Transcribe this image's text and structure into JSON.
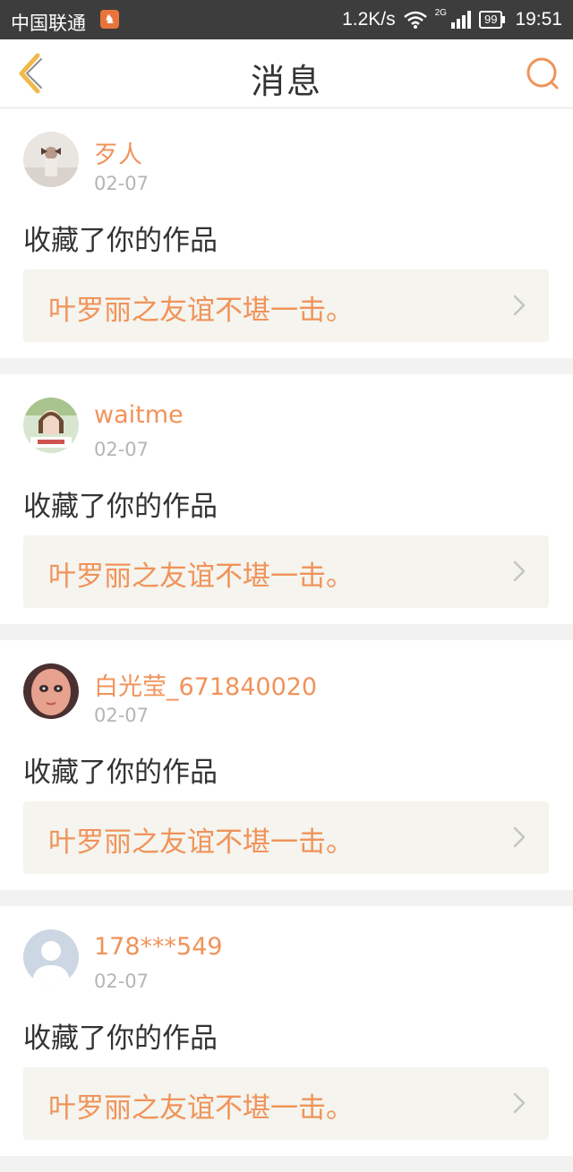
{
  "status_bar": {
    "carrier": "中国联通",
    "speed": "1.2K/s",
    "network_type": "2G",
    "battery": "99",
    "time": "19:51"
  },
  "nav": {
    "title": "消息",
    "back_icon": "chevron-left-icon",
    "search_icon": "search-icon"
  },
  "colors": {
    "accent": "#f0935a",
    "back_arrow": "#f2b84b",
    "work_box_bg": "#f5f4ee"
  },
  "messages": [
    {
      "username": "歹人",
      "date": "02-07",
      "action": "收藏了你的作品",
      "work_title": "叶罗丽之友谊不堪一击。"
    },
    {
      "username": "waitme",
      "date": "02-07",
      "action": "收藏了你的作品",
      "work_title": "叶罗丽之友谊不堪一击。"
    },
    {
      "username": "白光莹_671840020",
      "date": "02-07",
      "action": "收藏了你的作品",
      "work_title": "叶罗丽之友谊不堪一击。"
    },
    {
      "username": "178***549",
      "date": "02-07",
      "action": "收藏了你的作品",
      "work_title": "叶罗丽之友谊不堪一击。"
    }
  ]
}
